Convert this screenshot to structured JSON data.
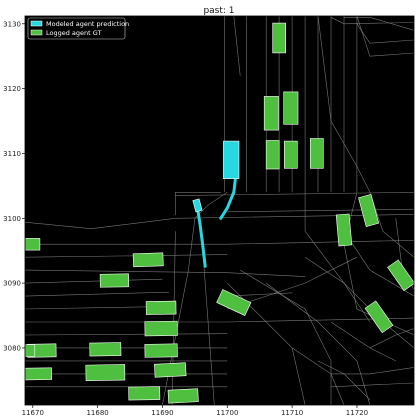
{
  "chart_data": {
    "type": "scatter",
    "title": "past: 1",
    "xlabel": "",
    "ylabel": "",
    "xlim": [
      11668.8,
      11728.8
    ],
    "ylim": [
      3071.2,
      3131.2
    ],
    "x_ticks": [
      11670,
      11680,
      11690,
      11700,
      11710,
      11720
    ],
    "y_ticks": [
      3080,
      3090,
      3100,
      3110,
      3120,
      3130
    ],
    "grid": false,
    "legend_position": "upper-left",
    "colors": {
      "background": "#000000",
      "map_lines": "#8c8c8c",
      "prediction": "#27d8e0",
      "logged_gt": "#4fbf3f",
      "box_edge": "#ffffff"
    },
    "legend": [
      {
        "label": "Modeled agent prediction",
        "color": "#27d8e0"
      },
      {
        "label": "Logged agent GT",
        "color": "#4fbf3f"
      }
    ],
    "map_lines": [
      [
        [
          11668.8,
          3099.4
        ],
        [
          11679,
          3098.4
        ],
        [
          11692,
          3100
        ]
      ],
      [
        [
          11668.8,
          3096
        ],
        [
          11700,
          3096
        ],
        [
          11728.8,
          3096.6
        ]
      ],
      [
        [
          11668.8,
          3094
        ],
        [
          11700,
          3094.4
        ]
      ],
      [
        [
          11668.8,
          3092
        ],
        [
          11700,
          3091.6
        ],
        [
          11712,
          3091
        ]
      ],
      [
        [
          11668.8,
          3090
        ],
        [
          11690,
          3090.6
        ]
      ],
      [
        [
          11668.8,
          3088
        ],
        [
          11691,
          3088.6
        ]
      ],
      [
        [
          11668.8,
          3086
        ],
        [
          11691,
          3086.4
        ]
      ],
      [
        [
          11668.8,
          3084
        ],
        [
          11700,
          3084
        ],
        [
          11728.8,
          3084.6
        ]
      ],
      [
        [
          11668.8,
          3082
        ],
        [
          11700,
          3082.2
        ]
      ],
      [
        [
          11668.8,
          3080
        ],
        [
          11700,
          3080
        ]
      ],
      [
        [
          11668.8,
          3078
        ],
        [
          11700,
          3078
        ]
      ],
      [
        [
          11668.8,
          3076
        ],
        [
          11700,
          3076
        ]
      ],
      [
        [
          11668.8,
          3074
        ],
        [
          11700,
          3074
        ]
      ],
      [
        [
          11692,
          3100.5
        ],
        [
          11692,
          3104
        ],
        [
          11699,
          3104
        ]
      ],
      [
        [
          11692,
          3103.5
        ],
        [
          11728.8,
          3104
        ]
      ],
      [
        [
          11700,
          3101
        ],
        [
          11728.8,
          3101.4
        ]
      ],
      [
        [
          11692,
          3100
        ],
        [
          11728.8,
          3100.6
        ]
      ],
      [
        [
          11699.6,
          3131.2
        ],
        [
          11699.6,
          3104
        ]
      ],
      [
        [
          11703,
          3131.2
        ],
        [
          11703,
          3104
        ]
      ],
      [
        [
          11701,
          3131.2
        ],
        [
          11702,
          3122
        ]
      ],
      [
        [
          11706,
          3131.2
        ],
        [
          11706,
          3104
        ]
      ],
      [
        [
          11708,
          3131.2
        ],
        [
          11708,
          3104
        ]
      ],
      [
        [
          11710,
          3131.2
        ],
        [
          11710,
          3104
        ]
      ],
      [
        [
          11712,
          3131.2
        ],
        [
          11712,
          3104
        ]
      ],
      [
        [
          11714,
          3131.2
        ],
        [
          11714,
          3104
        ]
      ],
      [
        [
          11716,
          3131.2
        ],
        [
          11716,
          3104
        ]
      ],
      [
        [
          11718,
          3131.2
        ],
        [
          11718,
          3104
        ]
      ],
      [
        [
          11720,
          3131.2
        ],
        [
          11720,
          3104
        ]
      ],
      [
        [
          11716,
          3131
        ],
        [
          11718,
          3130
        ],
        [
          11728.8,
          3130.2
        ]
      ],
      [
        [
          11718,
          3131
        ],
        [
          11722,
          3131
        ],
        [
          11728.8,
          3129
        ]
      ],
      [
        [
          11720,
          3130
        ],
        [
          11722,
          3127
        ],
        [
          11728.8,
          3127.5
        ]
      ],
      [
        [
          11720,
          3131.2
        ],
        [
          11722,
          3125
        ],
        [
          11728.8,
          3125.5
        ]
      ],
      [
        [
          11714,
          3131.2
        ],
        [
          11716,
          3115
        ],
        [
          11720,
          3108
        ],
        [
          11722,
          3104
        ]
      ],
      [
        [
          11700,
          3104
        ],
        [
          11697,
          3102
        ],
        [
          11695,
          3100
        ],
        [
          11694,
          3092
        ]
      ],
      [
        [
          11694,
          3092
        ],
        [
          11690,
          3071.2
        ]
      ],
      [
        [
          11692,
          3098
        ],
        [
          11691.5,
          3071.2
        ]
      ],
      [
        [
          11696,
          3098
        ],
        [
          11698,
          3071.2
        ]
      ],
      [
        [
          11700,
          3090
        ],
        [
          11710,
          3080
        ],
        [
          11712,
          3071.2
        ]
      ],
      [
        [
          11702,
          3092
        ],
        [
          11712,
          3086
        ],
        [
          11716,
          3078
        ],
        [
          11716,
          3071.2
        ]
      ],
      [
        [
          11706,
          3090
        ],
        [
          11714,
          3084
        ],
        [
          11720,
          3078
        ],
        [
          11722,
          3071.2
        ]
      ],
      [
        [
          11712,
          3094
        ],
        [
          11718,
          3090
        ],
        [
          11724,
          3084
        ],
        [
          11728.8,
          3080
        ]
      ],
      [
        [
          11718,
          3098
        ],
        [
          11722,
          3092
        ],
        [
          11728.8,
          3088
        ]
      ],
      [
        [
          11720,
          3104
        ],
        [
          11718,
          3096
        ],
        [
          11720,
          3086
        ],
        [
          11728.8,
          3082
        ]
      ],
      [
        [
          11712,
          3104
        ],
        [
          11712,
          3098
        ],
        [
          11718,
          3090
        ],
        [
          11722,
          3084
        ]
      ],
      [
        [
          11716,
          3076
        ],
        [
          11722,
          3076
        ],
        [
          11728.8,
          3077
        ]
      ],
      [
        [
          11716,
          3074
        ],
        [
          11728.8,
          3074.6
        ]
      ],
      [
        [
          11710,
          3080
        ],
        [
          11716,
          3076
        ],
        [
          11718,
          3071.2
        ]
      ],
      [
        [
          11722,
          3104
        ],
        [
          11724,
          3098
        ],
        [
          11728.8,
          3094
        ]
      ],
      [
        [
          11726,
          3100
        ],
        [
          11727,
          3092
        ],
        [
          11728.8,
          3089
        ]
      ],
      [
        [
          11700,
          3086
        ],
        [
          11706,
          3088
        ],
        [
          11712,
          3090
        ],
        [
          11720,
          3094
        ]
      ],
      [
        [
          11700,
          3088
        ],
        [
          11710,
          3088.5
        ]
      ],
      [
        [
          11714,
          3078
        ],
        [
          11718,
          3076
        ],
        [
          11722,
          3072
        ]
      ],
      [
        [
          11722,
          3080
        ],
        [
          11726,
          3082
        ],
        [
          11728.8,
          3083
        ]
      ],
      [
        [
          11716,
          3084
        ],
        [
          11722,
          3080
        ],
        [
          11726,
          3078
        ]
      ]
    ],
    "logged_gt": [
      {
        "x": 11669.6,
        "y": 3096.0,
        "w": 3.0,
        "h": 1.8,
        "angle": 0
      },
      {
        "x": 11687.8,
        "y": 3093.6,
        "w": 4.6,
        "h": 2.0,
        "angle": 2
      },
      {
        "x": 11682.6,
        "y": 3090.4,
        "w": 4.4,
        "h": 2.0,
        "angle": 1
      },
      {
        "x": 11689.8,
        "y": 3086.2,
        "w": 4.6,
        "h": 2.0,
        "angle": 1
      },
      {
        "x": 11689.8,
        "y": 3083.0,
        "w": 5.0,
        "h": 2.2,
        "angle": 1
      },
      {
        "x": 11671.4,
        "y": 3079.6,
        "w": 4.4,
        "h": 2.0,
        "angle": 1
      },
      {
        "x": 11669.4,
        "y": 3079.6,
        "w": 1.8,
        "h": 1.8,
        "angle": 0
      },
      {
        "x": 11681.2,
        "y": 3079.8,
        "w": 4.8,
        "h": 2.0,
        "angle": 1
      },
      {
        "x": 11689.8,
        "y": 3079.6,
        "w": 5.0,
        "h": 2.0,
        "angle": 1
      },
      {
        "x": 11670.8,
        "y": 3076.0,
        "w": 4.2,
        "h": 1.8,
        "angle": 1
      },
      {
        "x": 11681.2,
        "y": 3076.2,
        "w": 6.0,
        "h": 2.4,
        "angle": 1
      },
      {
        "x": 11691.2,
        "y": 3076.6,
        "w": 4.8,
        "h": 2.0,
        "angle": 3
      },
      {
        "x": 11687.2,
        "y": 3073.0,
        "w": 4.8,
        "h": 2.0,
        "angle": 1
      },
      {
        "x": 11693.2,
        "y": 3072.6,
        "w": 4.6,
        "h": 2.0,
        "angle": 3
      },
      {
        "x": 11701.0,
        "y": 3087.0,
        "w": 4.8,
        "h": 2.2,
        "angle": -25
      },
      {
        "x": 11708.0,
        "y": 3127.8,
        "w": 2.0,
        "h": 4.6,
        "angle": 0
      },
      {
        "x": 11706.8,
        "y": 3116.2,
        "w": 2.2,
        "h": 5.2,
        "angle": 0
      },
      {
        "x": 11709.8,
        "y": 3117.0,
        "w": 2.2,
        "h": 5.0,
        "angle": 0
      },
      {
        "x": 11707.0,
        "y": 3109.8,
        "w": 2.0,
        "h": 4.4,
        "angle": 0
      },
      {
        "x": 11709.8,
        "y": 3109.8,
        "w": 2.0,
        "h": 4.2,
        "angle": 0
      },
      {
        "x": 11713.8,
        "y": 3110.0,
        "w": 2.0,
        "h": 4.6,
        "angle": 0
      },
      {
        "x": 11718.0,
        "y": 3098.2,
        "w": 2.0,
        "h": 4.8,
        "angle": 5
      },
      {
        "x": 11721.8,
        "y": 3101.2,
        "w": 2.0,
        "h": 4.6,
        "angle": 15
      },
      {
        "x": 11726.8,
        "y": 3091.2,
        "w": 2.0,
        "h": 4.4,
        "angle": 35
      },
      {
        "x": 11723.4,
        "y": 3084.8,
        "w": 2.0,
        "h": 4.6,
        "angle": 35
      }
    ],
    "prediction_boxes": [
      {
        "x": 11700.6,
        "y": 3109.0,
        "w": 2.4,
        "h": 5.8,
        "angle": 0
      },
      {
        "x": 11695.4,
        "y": 3102.0,
        "w": 1.0,
        "h": 1.8,
        "angle": 15
      }
    ],
    "prediction_trajectories": [
      [
        [
          11701.4,
          3107.4
        ],
        [
          11701.0,
          3104.0
        ],
        [
          11700.0,
          3101.6
        ],
        [
          11699.0,
          3100.0
        ]
      ],
      [
        [
          11695.4,
          3101.6
        ],
        [
          11695.8,
          3099.0
        ],
        [
          11696.2,
          3096.0
        ],
        [
          11696.6,
          3092.6
        ]
      ]
    ]
  }
}
